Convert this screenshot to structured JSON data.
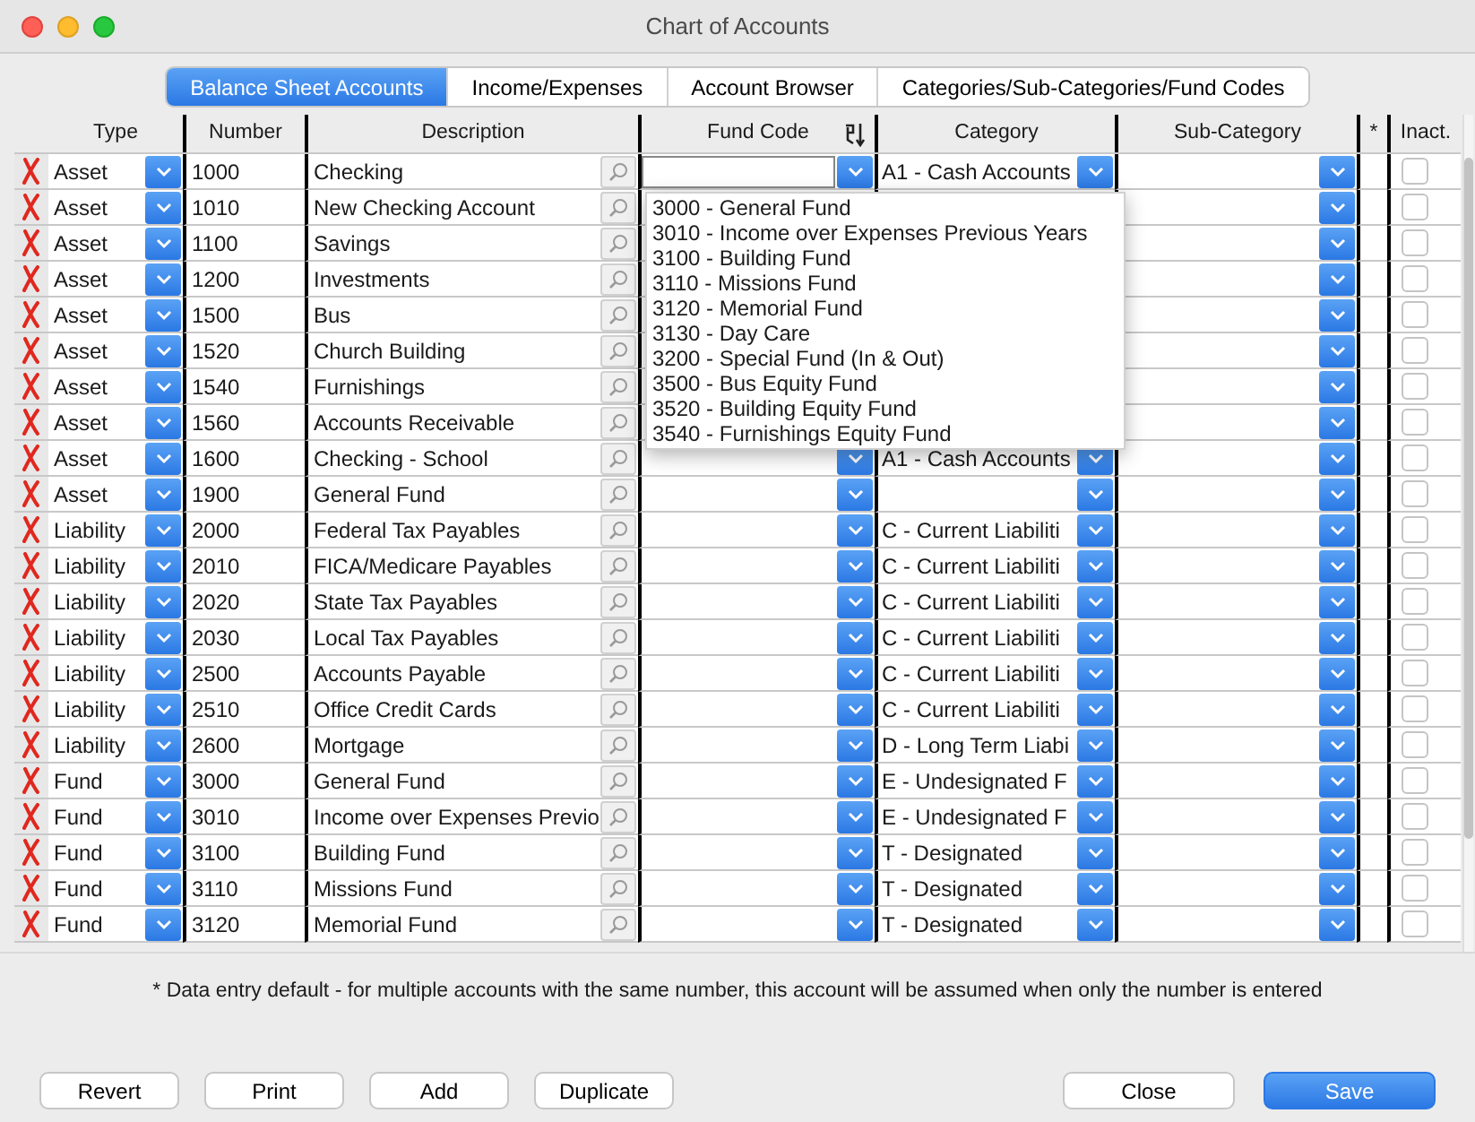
{
  "window": {
    "title": "Chart of Accounts"
  },
  "tabs": [
    {
      "label": "Balance Sheet Accounts",
      "selected": true
    },
    {
      "label": "Income/Expenses",
      "selected": false
    },
    {
      "label": "Account Browser",
      "selected": false
    },
    {
      "label": "Categories/Sub-Categories/Fund Codes",
      "selected": false
    }
  ],
  "table": {
    "columns": [
      "Type",
      "Number",
      "Description",
      "Fund Code",
      "Category",
      "Sub-Category",
      "*",
      "Inact."
    ],
    "rows": [
      {
        "type": "Asset",
        "number": "1000",
        "description": "Checking",
        "category": "A1 - Cash Accounts",
        "inactive": false
      },
      {
        "type": "Asset",
        "number": "1010",
        "description": "New Checking Account",
        "inactive": false
      },
      {
        "type": "Asset",
        "number": "1100",
        "description": "Savings",
        "inactive": false
      },
      {
        "type": "Asset",
        "number": "1200",
        "description": "Investments",
        "inactive": false
      },
      {
        "type": "Asset",
        "number": "1500",
        "description": "Bus",
        "inactive": false
      },
      {
        "type": "Asset",
        "number": "1520",
        "description": "Church Building",
        "inactive": false
      },
      {
        "type": "Asset",
        "number": "1540",
        "description": "Furnishings",
        "inactive": false
      },
      {
        "type": "Asset",
        "number": "1560",
        "description": "Accounts Receivable",
        "inactive": false
      },
      {
        "type": "Asset",
        "number": "1600",
        "description": "Checking - School",
        "category": "A1 - Cash Accounts",
        "inactive": false
      },
      {
        "type": "Asset",
        "number": "1900",
        "description": "General Fund",
        "category": "",
        "inactive": false
      },
      {
        "type": "Liability",
        "number": "2000",
        "description": "Federal Tax Payables",
        "category": "C - Current Liabiliti",
        "inactive": false
      },
      {
        "type": "Liability",
        "number": "2010",
        "description": "FICA/Medicare Payables",
        "category": "C - Current Liabiliti",
        "inactive": false
      },
      {
        "type": "Liability",
        "number": "2020",
        "description": "State Tax Payables",
        "category": "C - Current Liabiliti",
        "inactive": false
      },
      {
        "type": "Liability",
        "number": "2030",
        "description": "Local Tax Payables",
        "category": "C - Current Liabiliti",
        "inactive": false
      },
      {
        "type": "Liability",
        "number": "2500",
        "description": "Accounts Payable",
        "category": "C - Current Liabiliti",
        "inactive": false
      },
      {
        "type": "Liability",
        "number": "2510",
        "description": "Office Credit Cards",
        "category": "C - Current Liabiliti",
        "inactive": false
      },
      {
        "type": "Liability",
        "number": "2600",
        "description": "Mortgage",
        "category": "D - Long Term Liabi",
        "inactive": false
      },
      {
        "type": "Fund",
        "number": "3000",
        "description": "General Fund",
        "category": "E - Undesignated F",
        "inactive": false
      },
      {
        "type": "Fund",
        "number": "3010",
        "description": "Income over Expenses Previo",
        "category": "E - Undesignated F",
        "inactive": false
      },
      {
        "type": "Fund",
        "number": "3100",
        "description": "Building Fund",
        "category": "T - Designated",
        "inactive": false
      },
      {
        "type": "Fund",
        "number": "3110",
        "description": "Missions Fund",
        "category": "T - Designated",
        "inactive": false
      },
      {
        "type": "Fund",
        "number": "3120",
        "description": "Memorial Fund",
        "category": "T - Designated",
        "inactive": false
      }
    ]
  },
  "fund_code_menu": {
    "options": [
      "3000 - General Fund",
      "3010 - Income over Expenses Previous Years",
      "3100 - Building Fund",
      "3110 - Missions Fund",
      "3120 - Memorial Fund",
      "3130 - Day Care",
      "3200 - Special Fund (In & Out)",
      "3500 - Bus Equity Fund",
      "3520 - Building Equity Fund",
      "3540 - Furnishings Equity Fund"
    ]
  },
  "footnote": "* Data entry default - for multiple accounts with the same number, this account will be assumed when only the number is entered",
  "buttons_left": [
    {
      "label": "Revert",
      "kind": "default"
    },
    {
      "label": "Print",
      "kind": "default"
    },
    {
      "label": "Add",
      "kind": "default"
    },
    {
      "label": "Duplicate",
      "kind": "default"
    }
  ],
  "buttons_right": [
    {
      "label": "Close",
      "kind": "default"
    },
    {
      "label": "Save",
      "kind": "primary"
    }
  ]
}
